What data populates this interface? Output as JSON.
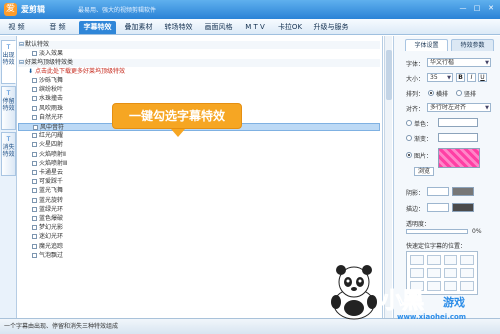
{
  "titlebar": {
    "logo_glyph": "爱",
    "app_name": "爱剪辑",
    "slogan": "最易用、强大的视频剪辑软件",
    "buttons": [
      "—",
      "□",
      "✕"
    ]
  },
  "tabs": [
    "视 频",
    "音 频",
    "字幕特效",
    "叠加素材",
    "转场特效",
    "画面风格",
    "M T V",
    "卡拉OK",
    "升级与服务"
  ],
  "active_tab_index": 2,
  "vertical_tabs": [
    {
      "icon": "T",
      "label": "出现特效"
    },
    {
      "icon": "T",
      "label": "停留特效"
    },
    {
      "icon": "T",
      "label": "消失特效"
    }
  ],
  "effect_groups": [
    {
      "label": "默认特效",
      "expanded": true,
      "items": [
        "淡入效果"
      ]
    },
    {
      "label": "好莱坞顶级特效类",
      "expanded": true
    }
  ],
  "link_text": "点击此处下载更多好莱坞顶级特效",
  "download_glyph": "⬇",
  "effects": [
    "沙砾飞舞",
    "缤纷秋叶",
    "水珠撞击",
    "风吹雨珠",
    "自然光环",
    "风中音符",
    "红光闪耀",
    "火星四射",
    "火焰喷射Ⅱ",
    "火焰喷射Ⅲ",
    "卡通星云",
    "可爱踩千",
    "蓝光飞舞",
    "蓝光旋转",
    "蓝绿光环",
    "蓝色爆破",
    "梦幻光影",
    "迷幻光环",
    "魔光追踪",
    "气泡飘过"
  ],
  "selected_effect": "风中音符",
  "tooltip": "一键勾选字幕特效",
  "right_panel": {
    "tabs": [
      "字体设置",
      "特效参数"
    ],
    "font_label": "字体：",
    "font_value": "华文行楷",
    "size_label": "大小：",
    "size_value": "35",
    "style_buttons": [
      "B",
      "I",
      "U"
    ],
    "layout_label": "排列：",
    "layout_options": [
      "横排",
      "竖排"
    ],
    "align_label": "对齐：",
    "align_value": "多行时左对齐",
    "single_color_label": "单色：",
    "gradient_label": "渐变：",
    "image_label": "图片：",
    "browse_label": "浏览",
    "shadow_label": "阴影：",
    "stroke_label": "描边：",
    "opacity_label": "透明度：",
    "opacity_value": "0%",
    "position_label": "快速定位字幕的位置：",
    "colors": {
      "image_swatch": "#ff3fa4",
      "shadow_swatch": "#777777",
      "stroke_swatch": "#4a4a4a"
    }
  },
  "status_text": "一个字幕由出现、停留和消失三种特效组成",
  "brand": {
    "big": "小黑",
    "small": "游戏",
    "url": "www.xiaohei.com"
  },
  "accent": "#2f86d8",
  "tooltip_color": "#f6a623",
  "brand_color": "#2c8de8"
}
